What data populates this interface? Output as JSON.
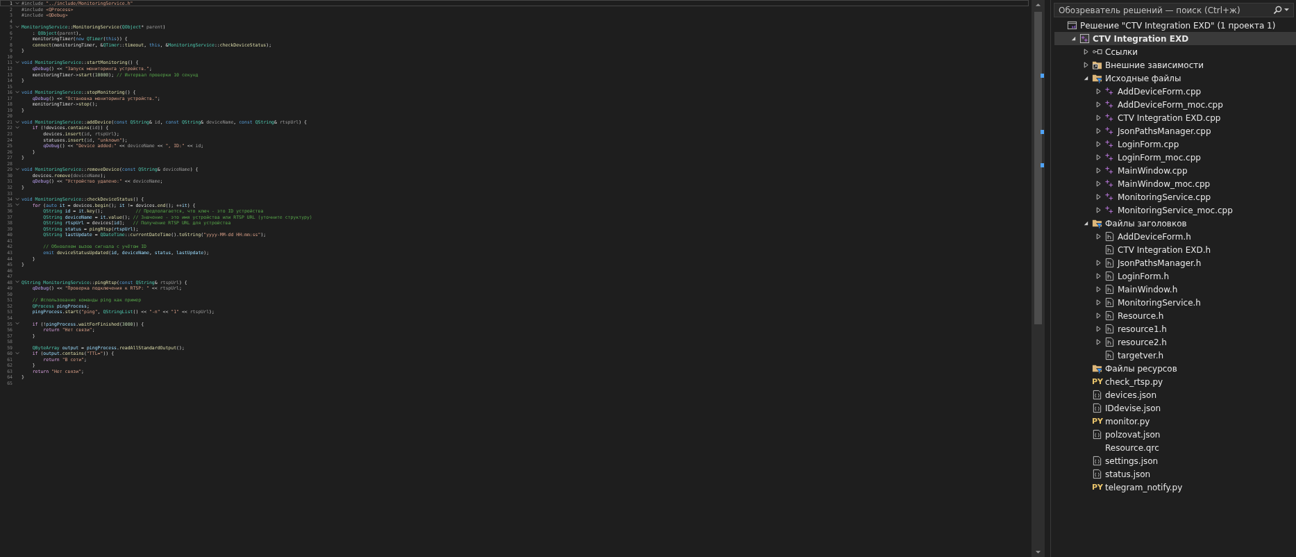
{
  "editor": {
    "lines": [
      {
        "n": "1",
        "fold": true,
        "current": true,
        "tokens": [
          {
            "kind": "h",
            "text": "#include "
          },
          {
            "kind": "s",
            "text": "\"../include/MonitoringService.h\""
          }
        ]
      },
      {
        "n": "2",
        "fold": false,
        "current": false,
        "tokens": [
          {
            "kind": "h",
            "text": "#include "
          },
          {
            "kind": "s",
            "text": "<QProcess>"
          }
        ]
      },
      {
        "n": "3",
        "fold": false,
        "current": false,
        "tokens": [
          {
            "kind": "h",
            "text": "#include "
          },
          {
            "kind": "s",
            "text": "<QDebug>"
          }
        ]
      },
      {
        "n": "4",
        "fold": false,
        "current": false
      },
      {
        "n": "5",
        "fold": true,
        "current": false,
        "tokens": [
          {
            "kind": "t",
            "text": "MonitoringService"
          },
          {
            "kind": "p",
            "text": "::"
          },
          {
            "kind": "f",
            "text": "MonitoringService"
          },
          {
            "kind": "p",
            "text": "("
          },
          {
            "kind": "t",
            "text": "QObject"
          },
          {
            "kind": "p",
            "text": "* "
          },
          {
            "kind": "a",
            "text": "parent"
          },
          {
            "kind": "p",
            "text": ")"
          }
        ]
      },
      {
        "n": "6",
        "fold": false,
        "current": false,
        "tokens": [
          {
            "kind": "p",
            "text": "    : "
          },
          {
            "kind": "t",
            "text": "QObject"
          },
          {
            "kind": "p",
            "text": "("
          },
          {
            "kind": "a",
            "text": "parent"
          },
          {
            "kind": "p",
            "text": "),"
          }
        ]
      },
      {
        "n": "7",
        "fold": false,
        "current": false,
        "tokens": [
          {
            "kind": "p",
            "text": "    monitoringTimer("
          },
          {
            "kind": "k",
            "text": "new "
          },
          {
            "kind": "t",
            "text": "QTimer"
          },
          {
            "kind": "p",
            "text": "("
          },
          {
            "kind": "k",
            "text": "this"
          },
          {
            "kind": "p",
            "text": ")) {"
          }
        ]
      },
      {
        "n": "8",
        "fold": false,
        "current": false,
        "tokens": [
          {
            "kind": "f",
            "text": "    connect"
          },
          {
            "kind": "p",
            "text": "(monitoringTimer, &"
          },
          {
            "kind": "t",
            "text": "QTimer"
          },
          {
            "kind": "p",
            "text": "::"
          },
          {
            "kind": "f",
            "text": "timeout"
          },
          {
            "kind": "p",
            "text": ", "
          },
          {
            "kind": "k",
            "text": "this"
          },
          {
            "kind": "p",
            "text": ", &"
          },
          {
            "kind": "t",
            "text": "MonitoringService"
          },
          {
            "kind": "p",
            "text": "::"
          },
          {
            "kind": "f",
            "text": "checkDeviceStatus"
          },
          {
            "kind": "p",
            "text": ");"
          }
        ]
      },
      {
        "n": "9",
        "fold": false,
        "current": false,
        "tokens": [
          {
            "kind": "p",
            "text": "}"
          }
        ]
      },
      {
        "n": "10",
        "fold": false,
        "current": false
      },
      {
        "n": "11",
        "fold": true,
        "current": false,
        "tokens": [
          {
            "kind": "k",
            "text": "void "
          },
          {
            "kind": "t",
            "text": "MonitoringService"
          },
          {
            "kind": "p",
            "text": "::"
          },
          {
            "kind": "f",
            "text": "startMonitoring"
          },
          {
            "kind": "p",
            "text": "() {"
          }
        ]
      },
      {
        "n": "12",
        "fold": false,
        "current": false,
        "tokens": [
          {
            "kind": "q",
            "text": "    qDebug"
          },
          {
            "kind": "p",
            "text": "() << "
          },
          {
            "kind": "s",
            "text": "\"Запуск мониторинга устройств.\""
          },
          {
            "kind": "p",
            "text": ";"
          }
        ]
      },
      {
        "n": "13",
        "fold": false,
        "current": false,
        "tokens": [
          {
            "kind": "p",
            "text": "    monitoringTimer->"
          },
          {
            "kind": "f",
            "text": "start"
          },
          {
            "kind": "p",
            "text": "("
          },
          {
            "kind": "n",
            "text": "10000"
          },
          {
            "kind": "p",
            "text": "); "
          },
          {
            "kind": "m",
            "text": "// Интервал проверки 10 секунд"
          }
        ]
      },
      {
        "n": "14",
        "fold": false,
        "current": false,
        "tokens": [
          {
            "kind": "p",
            "text": "}"
          }
        ]
      },
      {
        "n": "15",
        "fold": false,
        "current": false
      },
      {
        "n": "16",
        "fold": true,
        "current": false,
        "tokens": [
          {
            "kind": "k",
            "text": "void "
          },
          {
            "kind": "t",
            "text": "MonitoringService"
          },
          {
            "kind": "p",
            "text": "::"
          },
          {
            "kind": "f",
            "text": "stopMonitoring"
          },
          {
            "kind": "p",
            "text": "() {"
          }
        ]
      },
      {
        "n": "17",
        "fold": false,
        "current": false,
        "tokens": [
          {
            "kind": "q",
            "text": "    qDebug"
          },
          {
            "kind": "p",
            "text": "() << "
          },
          {
            "kind": "s",
            "text": "\"Остановка мониторинга устройств.\""
          },
          {
            "kind": "p",
            "text": ";"
          }
        ]
      },
      {
        "n": "18",
        "fold": false,
        "current": false,
        "tokens": [
          {
            "kind": "p",
            "text": "    monitoringTimer->"
          },
          {
            "kind": "f",
            "text": "stop"
          },
          {
            "kind": "p",
            "text": "();"
          }
        ]
      },
      {
        "n": "19",
        "fold": false,
        "current": false,
        "tokens": [
          {
            "kind": "p",
            "text": "}"
          }
        ]
      },
      {
        "n": "20",
        "fold": false,
        "current": false
      },
      {
        "n": "21",
        "fold": true,
        "current": false,
        "tokens": [
          {
            "kind": "k",
            "text": "void "
          },
          {
            "kind": "t",
            "text": "MonitoringService"
          },
          {
            "kind": "p",
            "text": "::"
          },
          {
            "kind": "f",
            "text": "addDevice"
          },
          {
            "kind": "p",
            "text": "("
          },
          {
            "kind": "k",
            "text": "const "
          },
          {
            "kind": "t",
            "text": "QString"
          },
          {
            "kind": "p",
            "text": "& "
          },
          {
            "kind": "a",
            "text": "id"
          },
          {
            "kind": "p",
            "text": ", "
          },
          {
            "kind": "k",
            "text": "const "
          },
          {
            "kind": "t",
            "text": "QString"
          },
          {
            "kind": "p",
            "text": "& "
          },
          {
            "kind": "a",
            "text": "deviceName"
          },
          {
            "kind": "p",
            "text": ", "
          },
          {
            "kind": "k",
            "text": "const "
          },
          {
            "kind": "t",
            "text": "QString"
          },
          {
            "kind": "p",
            "text": "& "
          },
          {
            "kind": "a",
            "text": "rtspUrl"
          },
          {
            "kind": "p",
            "text": ") {"
          }
        ]
      },
      {
        "n": "22",
        "fold": true,
        "current": false,
        "tokens": [
          {
            "kind": "c",
            "text": "    if"
          },
          {
            "kind": "p",
            "text": " (!devices."
          },
          {
            "kind": "f",
            "text": "contains"
          },
          {
            "kind": "p",
            "text": "("
          },
          {
            "kind": "a",
            "text": "id"
          },
          {
            "kind": "p",
            "text": ")) {"
          }
        ]
      },
      {
        "n": "23",
        "fold": false,
        "current": false,
        "tokens": [
          {
            "kind": "p",
            "text": "        devices."
          },
          {
            "kind": "f",
            "text": "insert"
          },
          {
            "kind": "p",
            "text": "("
          },
          {
            "kind": "a",
            "text": "id"
          },
          {
            "kind": "p",
            "text": ", "
          },
          {
            "kind": "a",
            "text": "rtspUrl"
          },
          {
            "kind": "p",
            "text": ");"
          }
        ]
      },
      {
        "n": "24",
        "fold": false,
        "current": false,
        "tokens": [
          {
            "kind": "p",
            "text": "        statuses."
          },
          {
            "kind": "f",
            "text": "insert"
          },
          {
            "kind": "p",
            "text": "("
          },
          {
            "kind": "a",
            "text": "id"
          },
          {
            "kind": "p",
            "text": ", "
          },
          {
            "kind": "s",
            "text": "\"unknown\""
          },
          {
            "kind": "p",
            "text": ");"
          }
        ]
      },
      {
        "n": "25",
        "fold": false,
        "current": false,
        "tokens": [
          {
            "kind": "q",
            "text": "        qDebug"
          },
          {
            "kind": "p",
            "text": "() << "
          },
          {
            "kind": "s",
            "text": "\"Device added:\""
          },
          {
            "kind": "p",
            "text": " << "
          },
          {
            "kind": "a",
            "text": "deviceName"
          },
          {
            "kind": "p",
            "text": " << "
          },
          {
            "kind": "s",
            "text": "\", ID:\""
          },
          {
            "kind": "p",
            "text": " << "
          },
          {
            "kind": "a",
            "text": "id"
          },
          {
            "kind": "p",
            "text": ";"
          }
        ]
      },
      {
        "n": "26",
        "fold": false,
        "current": false,
        "tokens": [
          {
            "kind": "p",
            "text": "    }"
          }
        ]
      },
      {
        "n": "27",
        "fold": false,
        "current": false,
        "tokens": [
          {
            "kind": "p",
            "text": "}"
          }
        ]
      },
      {
        "n": "28",
        "fold": false,
        "current": false
      },
      {
        "n": "29",
        "fold": true,
        "current": false,
        "tokens": [
          {
            "kind": "k",
            "text": "void "
          },
          {
            "kind": "t",
            "text": "MonitoringService"
          },
          {
            "kind": "p",
            "text": "::"
          },
          {
            "kind": "f",
            "text": "removeDevice"
          },
          {
            "kind": "p",
            "text": "("
          },
          {
            "kind": "k",
            "text": "const "
          },
          {
            "kind": "t",
            "text": "QString"
          },
          {
            "kind": "p",
            "text": "& "
          },
          {
            "kind": "a",
            "text": "deviceName"
          },
          {
            "kind": "p",
            "text": ") {"
          }
        ]
      },
      {
        "n": "30",
        "fold": false,
        "current": false,
        "tokens": [
          {
            "kind": "p",
            "text": "    devices."
          },
          {
            "kind": "f",
            "text": "remove"
          },
          {
            "kind": "p",
            "text": "("
          },
          {
            "kind": "a",
            "text": "deviceName"
          },
          {
            "kind": "p",
            "text": ");"
          }
        ]
      },
      {
        "n": "31",
        "fold": false,
        "current": false,
        "tokens": [
          {
            "kind": "q",
            "text": "    qDebug"
          },
          {
            "kind": "p",
            "text": "() << "
          },
          {
            "kind": "s",
            "text": "\"Устройство удалено:\""
          },
          {
            "kind": "p",
            "text": " << "
          },
          {
            "kind": "a",
            "text": "deviceName"
          },
          {
            "kind": "p",
            "text": ";"
          }
        ]
      },
      {
        "n": "32",
        "fold": false,
        "current": false,
        "tokens": [
          {
            "kind": "p",
            "text": "}"
          }
        ]
      },
      {
        "n": "33",
        "fold": false,
        "current": false
      },
      {
        "n": "34",
        "fold": true,
        "current": false,
        "tokens": [
          {
            "kind": "k",
            "text": "void "
          },
          {
            "kind": "t",
            "text": "MonitoringService"
          },
          {
            "kind": "p",
            "text": "::"
          },
          {
            "kind": "f",
            "text": "checkDeviceStatus"
          },
          {
            "kind": "p",
            "text": "() {"
          }
        ]
      },
      {
        "n": "35",
        "fold": true,
        "current": false,
        "tokens": [
          {
            "kind": "c",
            "text": "    for"
          },
          {
            "kind": "p",
            "text": " ("
          },
          {
            "kind": "k",
            "text": "auto "
          },
          {
            "kind": "e",
            "text": "it"
          },
          {
            "kind": "p",
            "text": " = devices."
          },
          {
            "kind": "f",
            "text": "begin"
          },
          {
            "kind": "p",
            "text": "(); "
          },
          {
            "kind": "e",
            "text": "it"
          },
          {
            "kind": "p",
            "text": " != devices."
          },
          {
            "kind": "f",
            "text": "end"
          },
          {
            "kind": "p",
            "text": "(); ++"
          },
          {
            "kind": "e",
            "text": "it"
          },
          {
            "kind": "p",
            "text": ") {"
          }
        ]
      },
      {
        "n": "36",
        "fold": false,
        "current": false,
        "tokens": [
          {
            "kind": "t",
            "text": "        QString "
          },
          {
            "kind": "e",
            "text": "id"
          },
          {
            "kind": "p",
            "text": " = "
          },
          {
            "kind": "e",
            "text": "it"
          },
          {
            "kind": "p",
            "text": "."
          },
          {
            "kind": "f",
            "text": "key"
          },
          {
            "kind": "p",
            "text": "();            "
          },
          {
            "kind": "m",
            "text": "// Предполагается, что ключ - это ID устройства"
          }
        ]
      },
      {
        "n": "37",
        "fold": false,
        "current": false,
        "tokens": [
          {
            "kind": "t",
            "text": "        QString "
          },
          {
            "kind": "e",
            "text": "deviceName"
          },
          {
            "kind": "p",
            "text": " = "
          },
          {
            "kind": "e",
            "text": "it"
          },
          {
            "kind": "p",
            "text": "."
          },
          {
            "kind": "f",
            "text": "value"
          },
          {
            "kind": "p",
            "text": "(); "
          },
          {
            "kind": "m",
            "text": "// Значение - это имя устройства или RTSP URL (уточните структуру)"
          }
        ]
      },
      {
        "n": "38",
        "fold": false,
        "current": false,
        "tokens": [
          {
            "kind": "t",
            "text": "        QString "
          },
          {
            "kind": "e",
            "text": "rtspUrl"
          },
          {
            "kind": "p",
            "text": " = devices["
          },
          {
            "kind": "e",
            "text": "id"
          },
          {
            "kind": "p",
            "text": "];   "
          },
          {
            "kind": "m",
            "text": "// Получение RTSP URL для устройства"
          }
        ]
      },
      {
        "n": "39",
        "fold": false,
        "current": false,
        "tokens": [
          {
            "kind": "t",
            "text": "        QString "
          },
          {
            "kind": "e",
            "text": "status"
          },
          {
            "kind": "p",
            "text": " = "
          },
          {
            "kind": "f",
            "text": "pingRtsp"
          },
          {
            "kind": "p",
            "text": "("
          },
          {
            "kind": "e",
            "text": "rtspUrl"
          },
          {
            "kind": "p",
            "text": ");"
          }
        ]
      },
      {
        "n": "40",
        "fold": false,
        "current": false,
        "tokens": [
          {
            "kind": "t",
            "text": "        QString "
          },
          {
            "kind": "e",
            "text": "lastUpdate"
          },
          {
            "kind": "p",
            "text": " = "
          },
          {
            "kind": "t",
            "text": "QDateTime"
          },
          {
            "kind": "p",
            "text": "::"
          },
          {
            "kind": "f",
            "text": "currentDateTime"
          },
          {
            "kind": "p",
            "text": "()."
          },
          {
            "kind": "f",
            "text": "toString"
          },
          {
            "kind": "p",
            "text": "("
          },
          {
            "kind": "s",
            "text": "\"yyyy-MM-dd HH:mm:ss\""
          },
          {
            "kind": "p",
            "text": ");"
          }
        ]
      },
      {
        "n": "41",
        "fold": false,
        "current": false
      },
      {
        "n": "42",
        "fold": false,
        "current": false,
        "tokens": [
          {
            "kind": "m",
            "text": "        // Обновляем вызов сигнала с учётом ID"
          }
        ]
      },
      {
        "n": "43",
        "fold": false,
        "current": false,
        "tokens": [
          {
            "kind": "k",
            "text": "        emit "
          },
          {
            "kind": "f",
            "text": "deviceStatusUpdated"
          },
          {
            "kind": "p",
            "text": "("
          },
          {
            "kind": "e",
            "text": "id"
          },
          {
            "kind": "p",
            "text": ", "
          },
          {
            "kind": "e",
            "text": "deviceName"
          },
          {
            "kind": "p",
            "text": ", "
          },
          {
            "kind": "e",
            "text": "status"
          },
          {
            "kind": "p",
            "text": ", "
          },
          {
            "kind": "e",
            "text": "lastUpdate"
          },
          {
            "kind": "p",
            "text": ");"
          }
        ]
      },
      {
        "n": "44",
        "fold": false,
        "current": false,
        "tokens": [
          {
            "kind": "p",
            "text": "    }"
          }
        ]
      },
      {
        "n": "45",
        "fold": false,
        "current": false,
        "tokens": [
          {
            "kind": "p",
            "text": "}"
          }
        ]
      },
      {
        "n": "46",
        "fold": false,
        "current": false
      },
      {
        "n": "47",
        "fold": false,
        "current": false
      },
      {
        "n": "48",
        "fold": true,
        "current": false,
        "tokens": [
          {
            "kind": "t",
            "text": "QString MonitoringService"
          },
          {
            "kind": "p",
            "text": "::"
          },
          {
            "kind": "f",
            "text": "pingRtsp"
          },
          {
            "kind": "p",
            "text": "("
          },
          {
            "kind": "k",
            "text": "const "
          },
          {
            "kind": "t",
            "text": "QString"
          },
          {
            "kind": "p",
            "text": "& "
          },
          {
            "kind": "a",
            "text": "rtspUrl"
          },
          {
            "kind": "p",
            "text": ") {"
          }
        ]
      },
      {
        "n": "49",
        "fold": false,
        "current": false,
        "tokens": [
          {
            "kind": "q",
            "text": "    qDebug"
          },
          {
            "kind": "p",
            "text": "() << "
          },
          {
            "kind": "s",
            "text": "\"Проверка подключения к RTSP: \""
          },
          {
            "kind": "p",
            "text": " << "
          },
          {
            "kind": "a",
            "text": "rtspUrl"
          },
          {
            "kind": "p",
            "text": ";"
          }
        ]
      },
      {
        "n": "50",
        "fold": false,
        "current": false
      },
      {
        "n": "51",
        "fold": false,
        "current": false,
        "tokens": [
          {
            "kind": "m",
            "text": "    // Использование команды ping как пример"
          }
        ]
      },
      {
        "n": "52",
        "fold": false,
        "current": false,
        "tokens": [
          {
            "kind": "t",
            "text": "    QProcess "
          },
          {
            "kind": "e",
            "text": "pingProcess"
          },
          {
            "kind": "p",
            "text": ";"
          }
        ]
      },
      {
        "n": "53",
        "fold": false,
        "current": false,
        "tokens": [
          {
            "kind": "e",
            "text": "    pingProcess"
          },
          {
            "kind": "p",
            "text": "."
          },
          {
            "kind": "f",
            "text": "start"
          },
          {
            "kind": "p",
            "text": "("
          },
          {
            "kind": "s",
            "text": "\"ping\""
          },
          {
            "kind": "p",
            "text": ", "
          },
          {
            "kind": "t",
            "text": "QStringList"
          },
          {
            "kind": "p",
            "text": "() << "
          },
          {
            "kind": "s",
            "text": "\"-n\""
          },
          {
            "kind": "p",
            "text": " << "
          },
          {
            "kind": "s",
            "text": "\"1\""
          },
          {
            "kind": "p",
            "text": " << "
          },
          {
            "kind": "a",
            "text": "rtspUrl"
          },
          {
            "kind": "p",
            "text": ");"
          }
        ]
      },
      {
        "n": "54",
        "fold": false,
        "current": false
      },
      {
        "n": "55",
        "fold": true,
        "current": false,
        "tokens": [
          {
            "kind": "c",
            "text": "    if"
          },
          {
            "kind": "p",
            "text": " (!"
          },
          {
            "kind": "e",
            "text": "pingProcess"
          },
          {
            "kind": "p",
            "text": "."
          },
          {
            "kind": "f",
            "text": "waitForFinished"
          },
          {
            "kind": "p",
            "text": "("
          },
          {
            "kind": "n",
            "text": "3000"
          },
          {
            "kind": "p",
            "text": ")) {"
          }
        ]
      },
      {
        "n": "56",
        "fold": false,
        "current": false,
        "tokens": [
          {
            "kind": "c",
            "text": "        return "
          },
          {
            "kind": "s",
            "text": "\"Нет связи\""
          },
          {
            "kind": "p",
            "text": ";"
          }
        ]
      },
      {
        "n": "57",
        "fold": false,
        "current": false,
        "tokens": [
          {
            "kind": "p",
            "text": "    }"
          }
        ]
      },
      {
        "n": "58",
        "fold": false,
        "current": false
      },
      {
        "n": "59",
        "fold": false,
        "current": false,
        "tokens": [
          {
            "kind": "t",
            "text": "    QByteArray "
          },
          {
            "kind": "e",
            "text": "output"
          },
          {
            "kind": "p",
            "text": " = "
          },
          {
            "kind": "e",
            "text": "pingProcess"
          },
          {
            "kind": "p",
            "text": "."
          },
          {
            "kind": "f",
            "text": "readAllStandardOutput"
          },
          {
            "kind": "p",
            "text": "();"
          }
        ]
      },
      {
        "n": "60",
        "fold": true,
        "current": false,
        "tokens": [
          {
            "kind": "c",
            "text": "    if"
          },
          {
            "kind": "p",
            "text": " ("
          },
          {
            "kind": "e",
            "text": "output"
          },
          {
            "kind": "p",
            "text": "."
          },
          {
            "kind": "f",
            "text": "contains"
          },
          {
            "kind": "p",
            "text": "("
          },
          {
            "kind": "s",
            "text": "\"TTL=\""
          },
          {
            "kind": "p",
            "text": ")) {"
          }
        ]
      },
      {
        "n": "61",
        "fold": false,
        "current": false,
        "tokens": [
          {
            "kind": "c",
            "text": "        return "
          },
          {
            "kind": "s",
            "text": "\"В сети\""
          },
          {
            "kind": "p",
            "text": ";"
          }
        ]
      },
      {
        "n": "62",
        "fold": false,
        "current": false,
        "tokens": [
          {
            "kind": "p",
            "text": "    }"
          }
        ]
      },
      {
        "n": "63",
        "fold": false,
        "current": false,
        "tokens": [
          {
            "kind": "c",
            "text": "    return "
          },
          {
            "kind": "s",
            "text": "\"Нет связи\""
          },
          {
            "kind": "p",
            "text": ";"
          }
        ]
      },
      {
        "n": "64",
        "fold": false,
        "current": false,
        "tokens": [
          {
            "kind": "p",
            "text": "}"
          }
        ]
      },
      {
        "n": "65",
        "fold": false,
        "current": false
      }
    ]
  },
  "solution_explorer": {
    "search": {
      "placeholder": "Обозреватель решений — поиск (Ctrl+ж)"
    },
    "tree": [
      {
        "kind": "solution",
        "label": "Решение \"CTV Integration EXD\"  (1 проекта 1)",
        "selected": false,
        "children": [
          {
            "kind": "project",
            "label": "CTV Integration EXD",
            "selected": true,
            "expanded": true,
            "children": [
              {
                "kind": "references",
                "label": "Ссылки",
                "selected": false,
                "expanded": false
              },
              {
                "kind": "external",
                "label": "Внешние зависимости",
                "selected": false,
                "expanded": false
              },
              {
                "kind": "filter",
                "label": "Исходные файлы",
                "selected": false,
                "expanded": true,
                "children": [
                  {
                    "kind": "cpp",
                    "label": "AddDeviceForm.cpp",
                    "selected": false,
                    "expanded": false
                  },
                  {
                    "kind": "cpp",
                    "label": "AddDeviceForm_moc.cpp",
                    "selected": false,
                    "expanded": false
                  },
                  {
                    "kind": "cpp",
                    "label": "CTV Integration EXD.cpp",
                    "selected": false,
                    "expanded": false
                  },
                  {
                    "kind": "cpp",
                    "label": "JsonPathsManager.cpp",
                    "selected": false,
                    "expanded": false
                  },
                  {
                    "kind": "cpp",
                    "label": "LoginForm.cpp",
                    "selected": false,
                    "expanded": false
                  },
                  {
                    "kind": "cpp",
                    "label": "LoginForm_moc.cpp",
                    "selected": false,
                    "expanded": false
                  },
                  {
                    "kind": "cpp",
                    "label": "MainWindow.cpp",
                    "selected": false,
                    "expanded": false
                  },
                  {
                    "kind": "cpp",
                    "label": "MainWindow_moc.cpp",
                    "selected": false,
                    "expanded": false
                  },
                  {
                    "kind": "cpp",
                    "label": "MonitoringService.cpp",
                    "selected": false,
                    "expanded": false
                  },
                  {
                    "kind": "cpp",
                    "label": "MonitoringService_moc.cpp",
                    "selected": false,
                    "expanded": false
                  }
                ]
              },
              {
                "kind": "filter",
                "label": "Файлы заголовков",
                "selected": false,
                "expanded": true,
                "children": [
                  {
                    "kind": "header",
                    "label": "AddDeviceForm.h",
                    "selected": false,
                    "expanded": false
                  },
                  {
                    "kind": "header",
                    "label": "CTV Integration EXD.h",
                    "selected": false
                  },
                  {
                    "kind": "header",
                    "label": "JsonPathsManager.h",
                    "selected": false,
                    "expanded": false
                  },
                  {
                    "kind": "header",
                    "label": "LoginForm.h",
                    "selected": false,
                    "expanded": false
                  },
                  {
                    "kind": "header",
                    "label": "MainWindow.h",
                    "selected": false,
                    "expanded": false
                  },
                  {
                    "kind": "header",
                    "label": "MonitoringService.h",
                    "selected": false,
                    "expanded": false
                  },
                  {
                    "kind": "header",
                    "label": "Resource.h",
                    "selected": false,
                    "expanded": false
                  },
                  {
                    "kind": "header",
                    "label": "resource1.h",
                    "selected": false,
                    "expanded": false
                  },
                  {
                    "kind": "header",
                    "label": "resource2.h",
                    "selected": false,
                    "expanded": false
                  },
                  {
                    "kind": "header",
                    "label": "targetver.h",
                    "selected": false
                  }
                ]
              },
              {
                "kind": "filter",
                "label": "Файлы ресурсов",
                "selected": false
              },
              {
                "kind": "python",
                "badge": "PY",
                "label": "check_rtsp.py",
                "selected": false
              },
              {
                "kind": "json",
                "label": "devices.json",
                "selected": false
              },
              {
                "kind": "json",
                "label": "IDdevise.json",
                "selected": false
              },
              {
                "kind": "python",
                "badge": "PY",
                "label": "monitor.py",
                "selected": false
              },
              {
                "kind": "json",
                "label": "polzovat.json",
                "selected": false
              },
              {
                "kind": "file",
                "label": "Resource.qrc",
                "selected": false
              },
              {
                "kind": "json",
                "label": "settings.json",
                "selected": false
              },
              {
                "kind": "json",
                "label": "status.json",
                "selected": false
              },
              {
                "kind": "python",
                "badge": "PY",
                "label": "telegram_notify.py",
                "selected": false
              }
            ]
          }
        ]
      }
    ]
  }
}
